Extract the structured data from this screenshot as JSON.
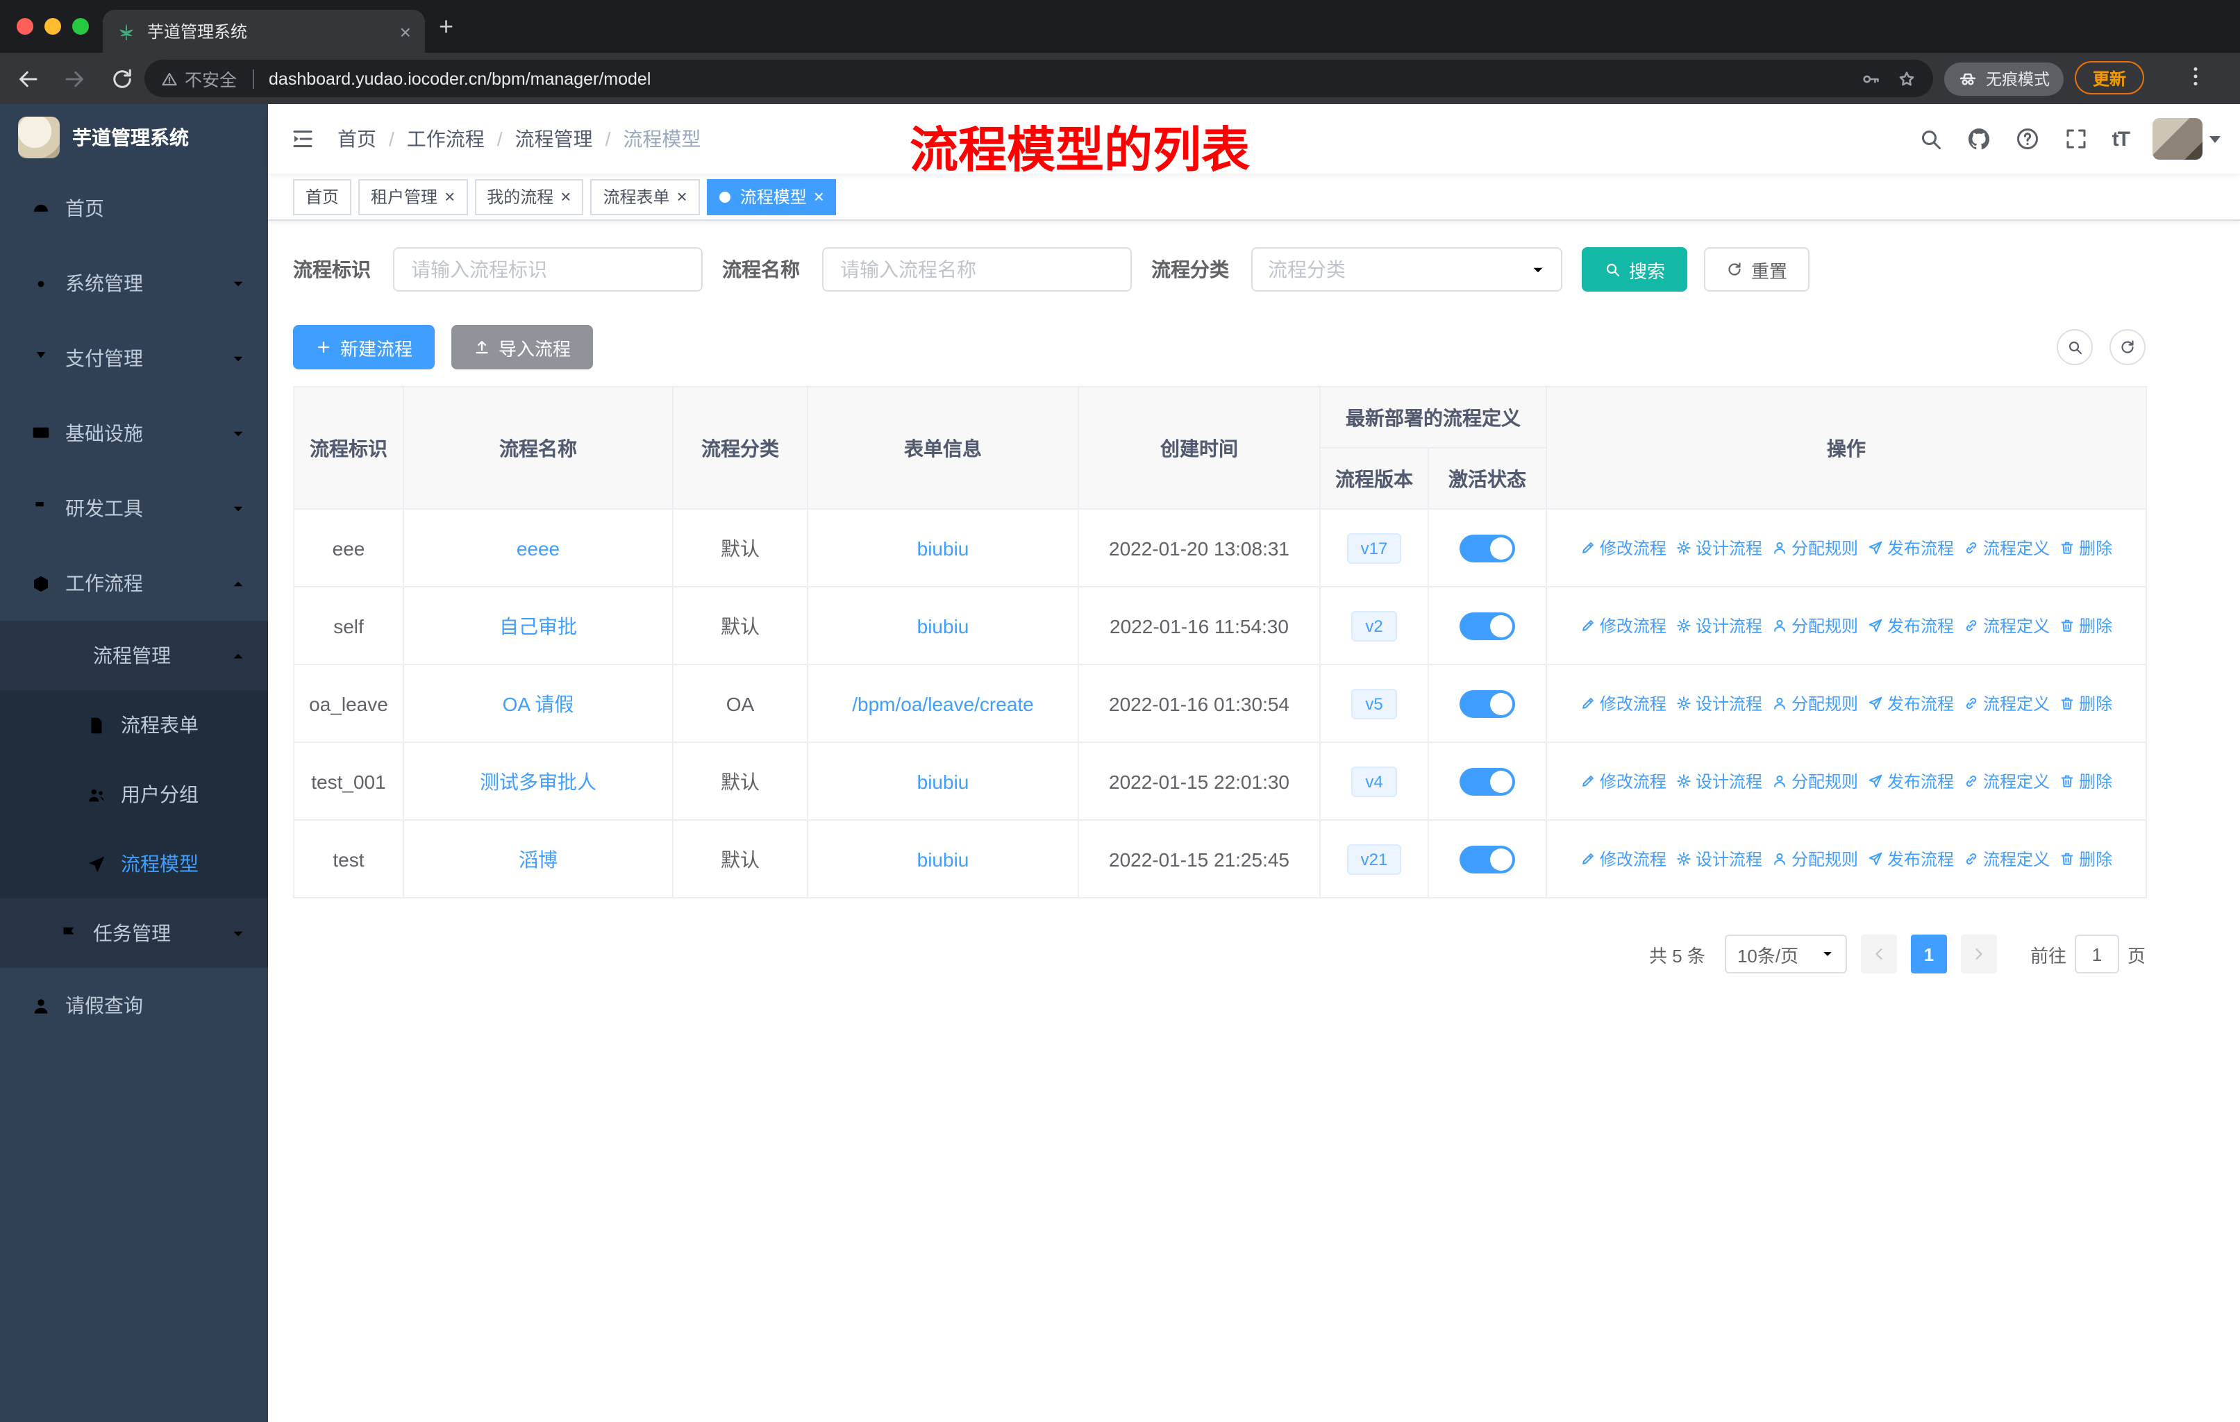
{
  "browser": {
    "tab_title": "芋道管理系统",
    "security_label": "不安全",
    "url": "dashboard.yudao.iocoder.cn/bpm/manager/model",
    "incognito_label": "无痕模式",
    "update_label": "更新"
  },
  "sidebar": {
    "app_title": "芋道管理系统",
    "items": [
      {
        "label": "首页",
        "icon": "dashboard-icon"
      },
      {
        "label": "系统管理",
        "icon": "gear-icon"
      },
      {
        "label": "支付管理",
        "icon": "yen-icon"
      },
      {
        "label": "基础设施",
        "icon": "monitor-icon"
      },
      {
        "label": "研发工具",
        "icon": "tools-icon"
      },
      {
        "label": "工作流程",
        "icon": "workflow-icon"
      },
      {
        "label": "流程管理",
        "icon": "list-icon"
      },
      {
        "label": "流程表单",
        "icon": "form-icon"
      },
      {
        "label": "用户分组",
        "icon": "users-icon"
      },
      {
        "label": "流程模型",
        "icon": "plane-icon"
      },
      {
        "label": "任务管理",
        "icon": "task-icon"
      },
      {
        "label": "请假查询",
        "icon": "person-icon"
      }
    ]
  },
  "navbar": {
    "breadcrumb": [
      "首页",
      "工作流程",
      "流程管理",
      "流程模型"
    ],
    "annotation": "流程模型的列表"
  },
  "tags": [
    {
      "label": "首页"
    },
    {
      "label": "租户管理"
    },
    {
      "label": "我的流程"
    },
    {
      "label": "流程表单"
    },
    {
      "label": "流程模型"
    }
  ],
  "filters": {
    "id_label": "流程标识",
    "id_placeholder": "请输入流程标识",
    "name_label": "流程名称",
    "name_placeholder": "请输入流程名称",
    "category_label": "流程分类",
    "category_placeholder": "流程分类",
    "search_label": "搜索",
    "reset_label": "重置"
  },
  "toolbar": {
    "create_label": "新建流程",
    "import_label": "导入流程"
  },
  "table": {
    "headers": {
      "id": "流程标识",
      "name": "流程名称",
      "category": "流程分类",
      "form": "表单信息",
      "created": "创建时间",
      "deploy_group": "最新部署的流程定义",
      "version": "流程版本",
      "status": "激活状态",
      "operation": "操作"
    },
    "actions": {
      "edit": "修改流程",
      "design": "设计流程",
      "assign": "分配规则",
      "publish": "发布流程",
      "define": "流程定义",
      "delete": "删除"
    },
    "rows": [
      {
        "id": "eee",
        "name": "eeee",
        "category": "默认",
        "form": "biubiu",
        "created": "2022-01-20 13:08:31",
        "version": "v17",
        "active": true
      },
      {
        "id": "self",
        "name": "自己审批",
        "category": "默认",
        "form": "biubiu",
        "created": "2022-01-16 11:54:30",
        "version": "v2",
        "active": true
      },
      {
        "id": "oa_leave",
        "name": "OA 请假",
        "category": "OA",
        "form": "/bpm/oa/leave/create",
        "created": "2022-01-16 01:30:54",
        "version": "v5",
        "active": true
      },
      {
        "id": "test_001",
        "name": "测试多审批人",
        "category": "默认",
        "form": "biubiu",
        "created": "2022-01-15 22:01:30",
        "version": "v4",
        "active": true
      },
      {
        "id": "test",
        "name": "滔博",
        "category": "默认",
        "form": "biubiu",
        "created": "2022-01-15 21:25:45",
        "version": "v21",
        "active": true
      }
    ]
  },
  "pagination": {
    "total": "共 5 条",
    "page_size": "10条/页",
    "page": "1",
    "goto_label": "前往",
    "goto_value": "1",
    "unit_label": "页"
  },
  "colors": {
    "primary": "#409eff",
    "search_button": "#14b8a6",
    "annotation_red": "#ff0000",
    "sidebar_bg": "#304156",
    "link_blue": "#409eff"
  }
}
